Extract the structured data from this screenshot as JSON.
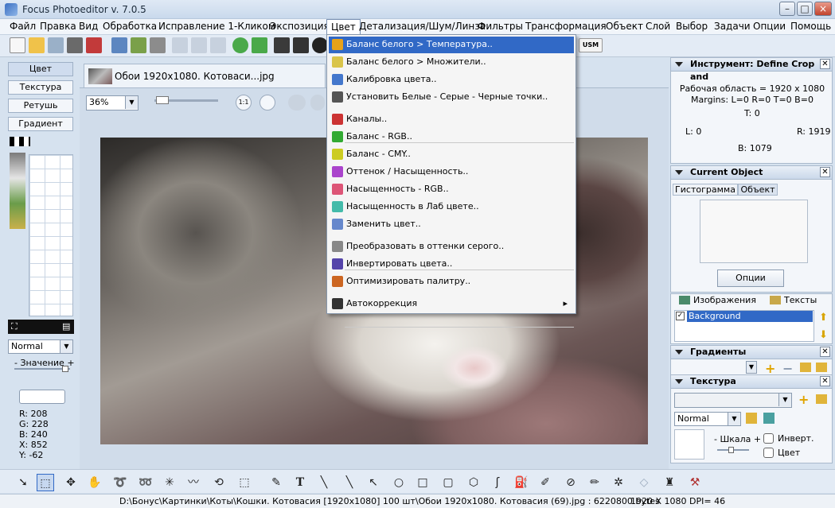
{
  "window": {
    "title": "Focus Photoeditor v. 7.0.5"
  },
  "menubar": [
    "Файл",
    "Правка",
    "Вид",
    "Обработка",
    "Исправление 1-Кликом",
    "Экспозиция",
    "Цвет",
    "Детализация/Шум/Линза",
    "Фильтры",
    "Трансформация",
    "Объект",
    "Слой",
    "Выбор",
    "Задачи",
    "Опции",
    "Помощь"
  ],
  "toolbar": {
    "usm_label": "USM"
  },
  "left_tabs": [
    "Цвет",
    "Текстура",
    "Ретушь",
    "Градиент"
  ],
  "left_panel": {
    "blend_mode": "Normal",
    "value_label": "- Значение +",
    "readout": {
      "r": "R: 208",
      "g": "G: 228",
      "b": "B: 240",
      "x": "X: 852",
      "y": "Y: -62"
    }
  },
  "document_tab": {
    "label": "Обои 1920x1080. Котоваси...jpg"
  },
  "zoom": {
    "value": "36%"
  },
  "color_menu": {
    "items": [
      {
        "label": "Баланс белого > Температура..",
        "icon_color": "#e8a21a"
      },
      {
        "label": "Баланс белого > Множители..",
        "icon_color": "#d9c44a"
      },
      {
        "label": "Калибровка цвета..",
        "icon_color": "#4477cc"
      },
      {
        "label": "Установить Белые - Серые - Черные точки..",
        "icon_color": "#555555"
      },
      {
        "label": "Каналы..",
        "icon_color": "#cc3333"
      },
      {
        "label": "Баланс - RGB..",
        "icon_color": "#33aa33"
      },
      {
        "label": "Баланс - CMY..",
        "icon_color": "#cccc22"
      },
      {
        "label": "Оттенок / Насыщенность..",
        "icon_color": "#aa44cc"
      },
      {
        "label": "Насыщенность - RGB..",
        "icon_color": "#dd5577"
      },
      {
        "label": "Насыщенность в Лаб цвете..",
        "icon_color": "#44bbaa"
      },
      {
        "label": "Заменить цвет..",
        "icon_color": "#6688cc"
      },
      {
        "label": "Преобразовать в оттенки серого..",
        "icon_color": "#888888"
      },
      {
        "label": "Инвертировать цвета..",
        "icon_color": "#5544aa"
      },
      {
        "label": "Оптимизировать палитру..",
        "icon_color": "#cc6622"
      },
      {
        "label": "Автокоррекция",
        "icon_color": "#333333",
        "submenu": "▸"
      }
    ]
  },
  "tool_panel": {
    "title": "Инструмент: Define Crop and",
    "workarea": "Рабочая область = 1920 x 1080",
    "margins": "Margins: L=0 R=0 T=0 B=0",
    "t": "T: 0",
    "l": "L: 0",
    "r": "R: 1919",
    "b": "B: 1079"
  },
  "current_object": {
    "title": "Current Object",
    "tabs": [
      "Гистограмма",
      "Объект"
    ],
    "options_button": "Опции"
  },
  "layers": {
    "tabs": [
      "Изображения",
      "Тексты"
    ],
    "item": "Background"
  },
  "gradients": {
    "title": "Градиенты"
  },
  "texture": {
    "title": "Текстура",
    "blend_mode": "Normal",
    "scale_label": "- Шкала +",
    "invert_label": "Инверт.",
    "color_label": "Цвет"
  },
  "status": {
    "path": "D:\\Бонус\\Картинки\\Коты\\Кошки. Котовасия [1920x1080] 100 шт\\Обои 1920x1080. Котовасия  (69).jpg : 6220800 bytes",
    "dims": "1920 X 1080 DPI= 46"
  }
}
